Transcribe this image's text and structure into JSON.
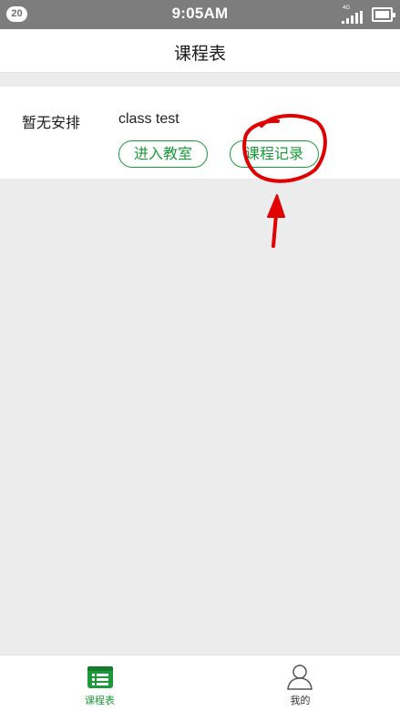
{
  "status_bar": {
    "notification_count": "20",
    "time": "9:05AM",
    "network": "4G",
    "icons": [
      "signal-icon",
      "battery-icon"
    ]
  },
  "header": {
    "title": "课程表"
  },
  "course": {
    "time_slot": "暂无安排",
    "name": "class test",
    "enter_button": "进入教室",
    "record_button": "课程记录"
  },
  "annotation": {
    "color": "#e00000",
    "description_icons": [
      "circle-annotation",
      "arrow-annotation"
    ]
  },
  "tab_bar": {
    "tabs": [
      {
        "label": "课程表",
        "icon": "schedule-icon",
        "active": true
      },
      {
        "label": "我的",
        "icon": "profile-icon",
        "active": false
      }
    ],
    "active_color": "#1b9a3a"
  }
}
